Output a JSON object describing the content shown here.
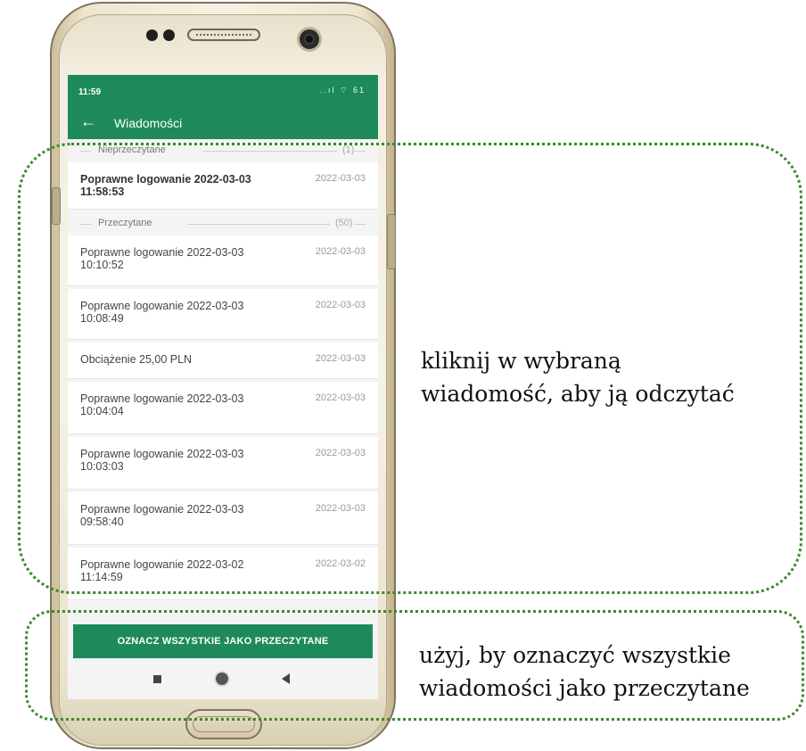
{
  "status_bar": {
    "time": "11:59",
    "indicators": "..ıl ⌔ 61"
  },
  "app_bar": {
    "back_icon": "←",
    "title": "Wiadomości"
  },
  "sections": [
    {
      "label": "Nieprzeczytane",
      "count": "(1)"
    },
    {
      "label": "Przeczytane",
      "count": "(50)"
    }
  ],
  "unread_messages": [
    {
      "title": "Poprawne logowanie 2022-03-03 11:58:53",
      "date": "2022-03-03"
    }
  ],
  "read_messages": [
    {
      "title": "Poprawne logowanie 2022-03-03 10:10:52",
      "date": "2022-03-03"
    },
    {
      "title": "Poprawne logowanie 2022-03-03 10:08:49",
      "date": "2022-03-03"
    },
    {
      "title": "Obciążenie 25,00 PLN",
      "date": "2022-03-03"
    },
    {
      "title": "Poprawne logowanie 2022-03-03 10:04:04",
      "date": "2022-03-03"
    },
    {
      "title": "Poprawne logowanie 2022-03-03 10:03:03",
      "date": "2022-03-03"
    },
    {
      "title": "Poprawne logowanie 2022-03-03 09:58:40",
      "date": "2022-03-03"
    },
    {
      "title": "Poprawne logowanie 2022-03-02 11:14:59",
      "date": "2022-03-02"
    }
  ],
  "mark_all_button": "OZNACZ WSZYSTKIE JAKO PRZECZYTANE",
  "callouts": {
    "messages_hint_line1": "kliknij w wybraną",
    "messages_hint_line2": "wiadomość, aby ją odczytać",
    "button_hint_line1": "użyj, by oznaczyć wszystkie",
    "button_hint_line2": "wiadomości jako przeczytane"
  },
  "colors": {
    "brand_green": "#1e8a5c",
    "callout_green": "#3a8a2c"
  }
}
